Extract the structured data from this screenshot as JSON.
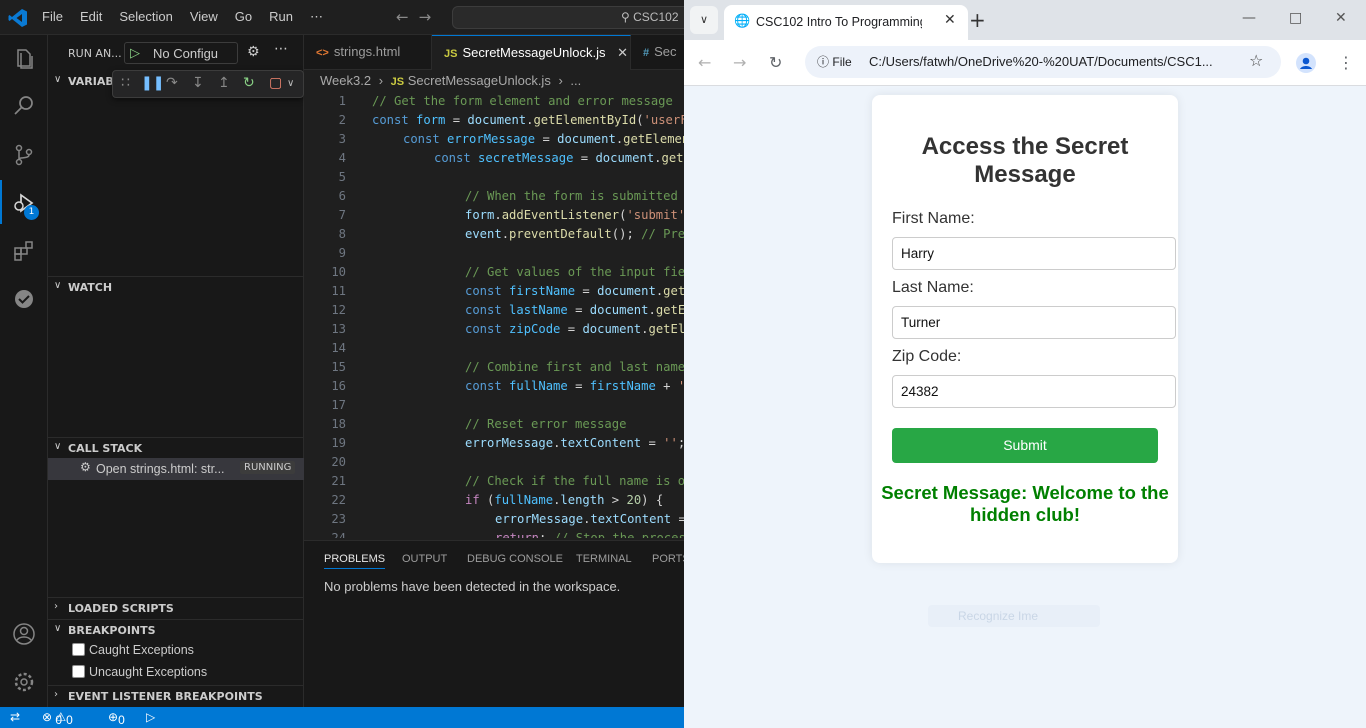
{
  "vscode": {
    "menu": [
      "File",
      "Edit",
      "Selection",
      "View",
      "Go",
      "Run",
      "⋯"
    ],
    "command_center": "CSC102",
    "run_header": "RUN AN...",
    "config_select": "No Configu",
    "sections": {
      "variables": "VARIABLES",
      "watch": "WATCH",
      "call_stack": "CALL STACK",
      "loaded_scripts": "LOADED SCRIPTS",
      "breakpoints": "BREAKPOINTS",
      "event_listener_breakpoints": "EVENT LISTENER BREAKPOINTS"
    },
    "call_stack_item": {
      "label": "Open strings.html: str...",
      "status": "RUNNING"
    },
    "breakpoint_options": [
      "Caught Exceptions",
      "Uncaught Exceptions"
    ],
    "debug_badge": "1",
    "tabs": [
      {
        "lang": "<>",
        "label": "strings.html",
        "active": false
      },
      {
        "lang": "JS",
        "label": "SecretMessageUnlock.js",
        "active": true
      },
      {
        "lang": "#",
        "label": "Sec",
        "active": false
      }
    ],
    "breadcrumb": {
      "folder": "Week3.2",
      "lang": "JS",
      "file": "SecretMessageUnlock.js",
      "rest": "..."
    },
    "code_line_numbers": [
      "1",
      "2",
      "3",
      "4",
      "5",
      "6",
      "7",
      "8",
      "9",
      "10",
      "11",
      "12",
      "13",
      "14",
      "15",
      "16",
      "17",
      "18",
      "19",
      "20",
      "21",
      "22",
      "23",
      "24"
    ],
    "panel_tabs": [
      "PROBLEMS",
      "OUTPUT",
      "DEBUG CONSOLE",
      "TERMINAL",
      "PORTS"
    ],
    "panel_message": "No problems have been detected in the workspace.",
    "status": {
      "errors": "0",
      "warnings": "0",
      "ports": "0"
    }
  },
  "chrome": {
    "tab_title": "CSC102 Intro To Programming |",
    "file_chip": "File",
    "url": "C:/Users/fatwh/OneDrive%20-%20UAT/Documents/CSC1..."
  },
  "page": {
    "title": "Access the Secret Message",
    "first_name_label": "First Name:",
    "first_name_value": "Harry",
    "last_name_label": "Last Name:",
    "last_name_value": "Turner",
    "zip_label": "Zip Code:",
    "zip_value": "24382",
    "submit_label": "Submit",
    "secret_message": "Secret Message: Welcome to the hidden club!",
    "ghost_text": "Recognize Ime"
  }
}
